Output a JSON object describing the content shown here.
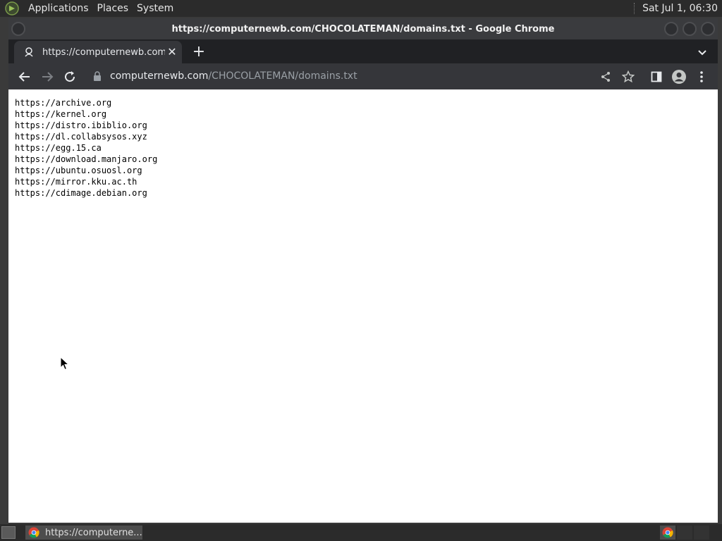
{
  "top_panel": {
    "menus": [
      "Applications",
      "Places",
      "System"
    ],
    "clock": "Sat Jul  1, 06:30"
  },
  "window": {
    "title": "https://computernewb.com/CHOCOLATEMAN/domains.txt - Google Chrome"
  },
  "tab": {
    "title": "https://computernewb.com/CHOCOLATEMAN/domains.txt"
  },
  "omnibox": {
    "host": "computernewb.com",
    "path": "/CHOCOLATEMAN/domains.txt"
  },
  "content": {
    "lines": [
      "https://archive.org",
      "https://kernel.org",
      "https://distro.ibiblio.org",
      "https://dl.collabsysos.xyz",
      "https://egg.15.ca",
      "https://download.manjaro.org",
      "https://ubuntu.osuosl.org",
      "https://mirror.kku.ac.th",
      "https://cdimage.debian.org"
    ]
  },
  "taskbar": {
    "task_label": "https://computerne..."
  },
  "colors": {
    "chrome_dark": "#202124",
    "toolbar": "#35363a",
    "page_bg": "#ffffff"
  }
}
